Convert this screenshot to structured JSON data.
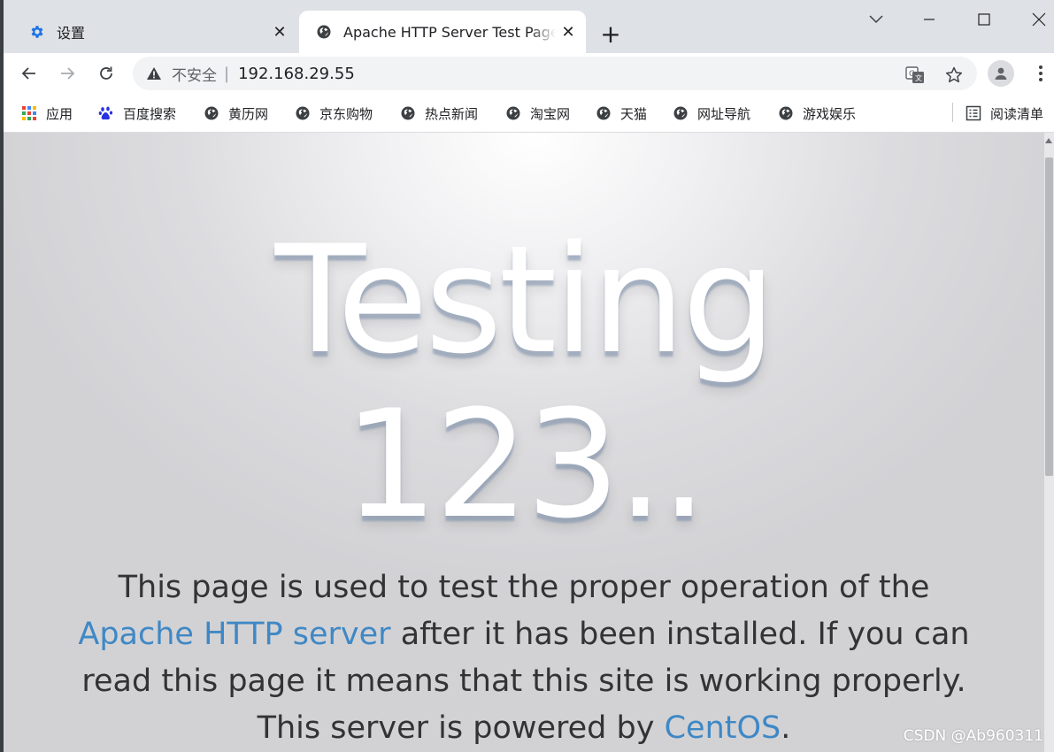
{
  "tabs": [
    {
      "title": "设置",
      "close": "✕"
    },
    {
      "title": "Apache HTTP Server Test Page",
      "close": "✕"
    }
  ],
  "new_tab": "+",
  "address_bar": {
    "security_text": "不安全",
    "separator": "|",
    "url": "192.168.29.55"
  },
  "bookmarks": [
    "应用",
    "百度搜索",
    "黄历网",
    "京东购物",
    "热点新闻",
    "淘宝网",
    "天猫",
    "网址导航",
    "游戏娱乐"
  ],
  "reading_list": "阅读清单",
  "page": {
    "heading_line1": "Testing",
    "heading_line2": "123..",
    "lead_before": "This page is used to test the proper operation of the ",
    "link_apache": "Apache HTTP server",
    "lead_middle": " after it has been installed. If you can read this page it means that this site is working properly. This server is powered by ",
    "link_centos": "CentOS",
    "lead_end": "."
  },
  "watermark": "CSDN @Ab960311",
  "colors": {
    "link": "#3f88c5",
    "tab_strip": "#dee1e6",
    "settings_icon": "#1a73e8"
  }
}
